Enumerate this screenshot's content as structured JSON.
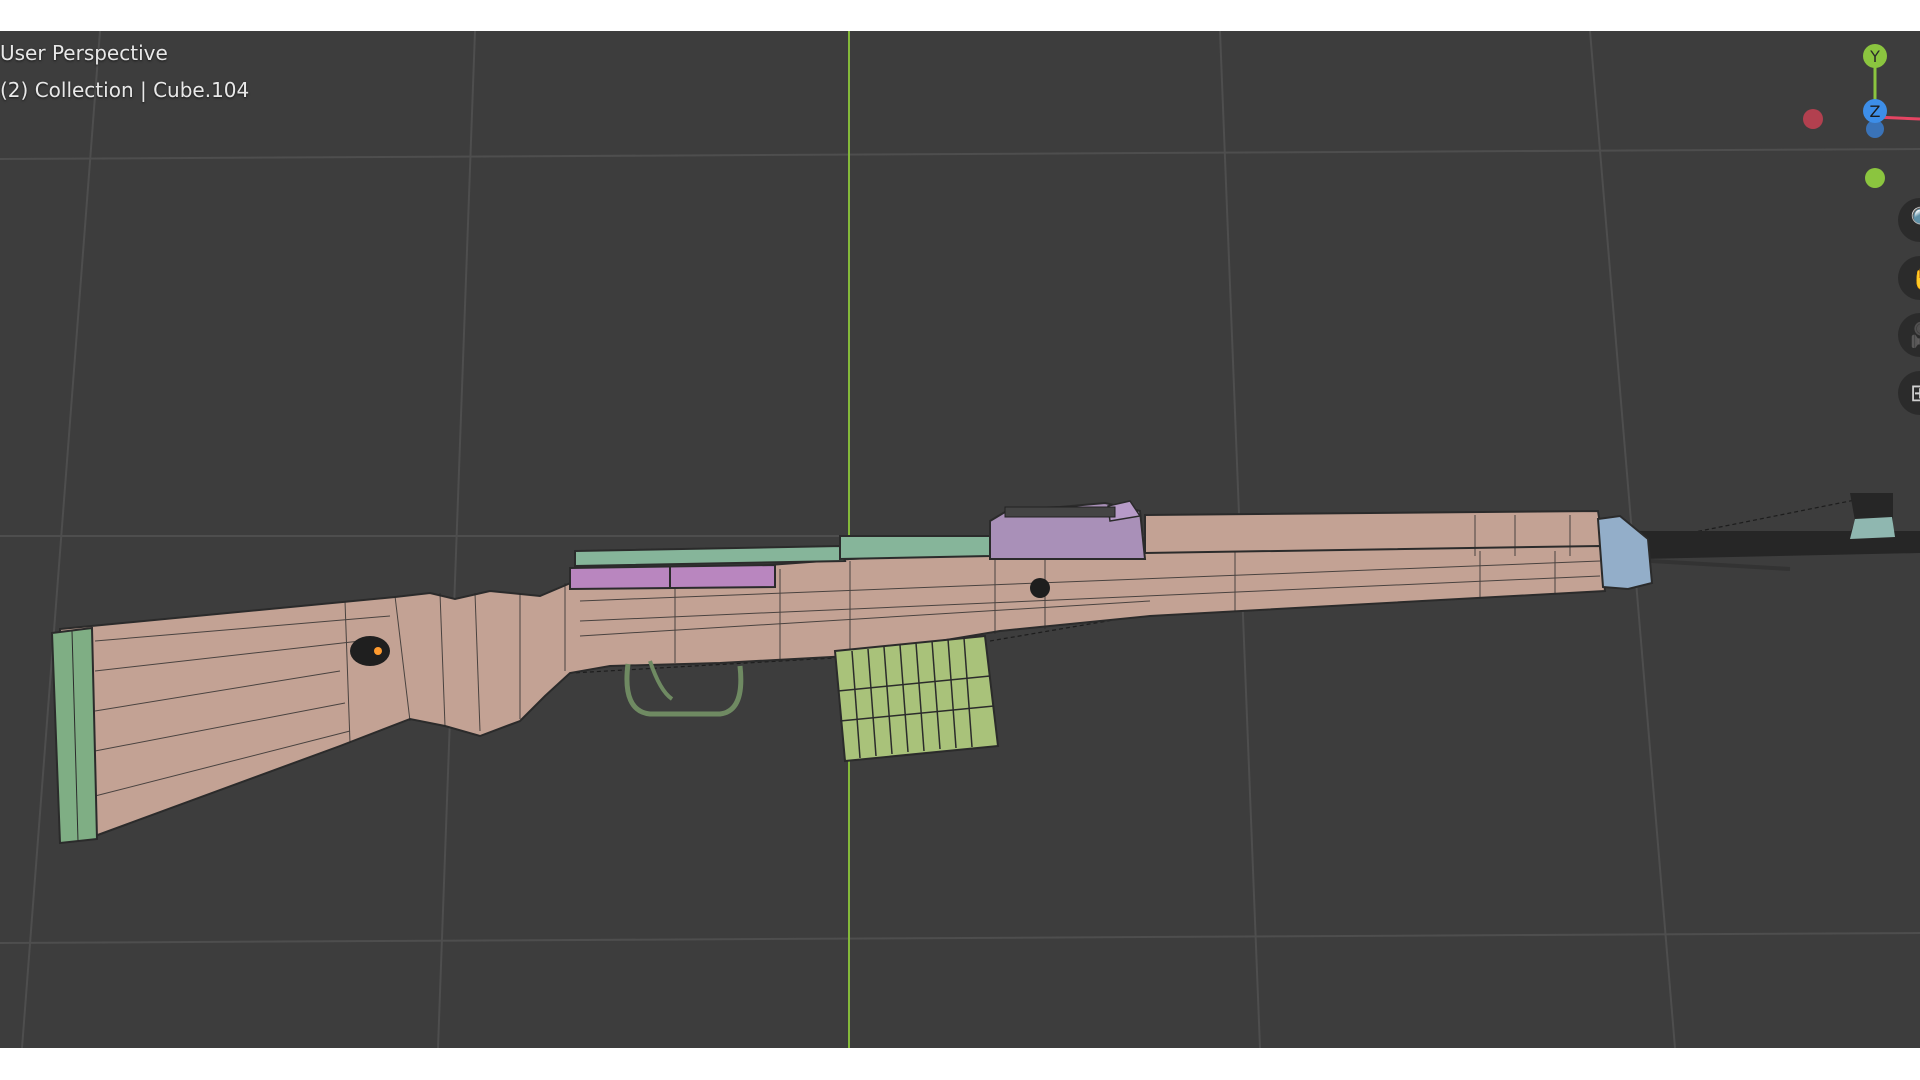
{
  "viewport": {
    "view_label": "User Perspective",
    "collection_label": "(2) Collection | Cube.104"
  },
  "gizmo": {
    "y_label": "Y",
    "z_label": "Z",
    "colors": {
      "x_axis": "#e64563",
      "x_negative": "#b2404f",
      "y_axis": "#8bc53f",
      "z_axis": "#3d8ee8",
      "z_negative": "#3a73b8"
    }
  },
  "nav_icons": {
    "zoom": "magnifier-icon",
    "pan": "hand-icon",
    "camera": "camera-icon",
    "ortho": "grid-ortho-icon"
  },
  "model_colors": {
    "wood": "#c3a294",
    "buttplate": "#7fae84",
    "receiver": "#a990b8",
    "bolt": "#86b59a",
    "magazine": "#a9c27a",
    "barrel_band": "#93aec9",
    "metal": "#2a2a2a"
  }
}
